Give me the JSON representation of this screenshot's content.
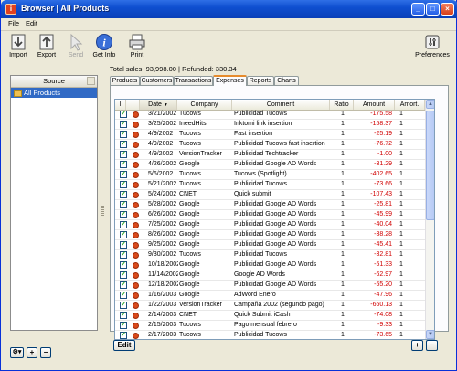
{
  "window": {
    "title": "Browser  |  All Products"
  },
  "menu": [
    "File",
    "Edit"
  ],
  "toolbar": {
    "import": "Import",
    "export": "Export",
    "send": "Send",
    "get_info": "Get Info",
    "print": "Print",
    "preferences": "Preferences"
  },
  "sidebar": {
    "header": "Source",
    "items": [
      "All Products"
    ]
  },
  "summary": "Total sales: 93,998.00 | Refunded: 330.34",
  "tabs": [
    "Products",
    "Customers",
    "Transactions",
    "Expenses",
    "Reports",
    "Charts"
  ],
  "active_tab": "Expenses",
  "table": {
    "columns": [
      "I",
      "Date",
      "Company",
      "Comment",
      "Ratio",
      "Amount",
      "Amort."
    ],
    "sort_indicator": "▼",
    "rows": [
      [
        "3/21/2002",
        "Tucows",
        "Publicidad Tucows",
        "1",
        "-175.58",
        "1"
      ],
      [
        "3/25/2002",
        "IneedHits",
        "Inktomi link insertion",
        "1",
        "-158.37",
        "1"
      ],
      [
        "4/9/2002",
        "Tucows",
        "Fast insertion",
        "1",
        "-25.19",
        "1"
      ],
      [
        "4/9/2002",
        "Tucows",
        "Publicidad Tucows fast insertion",
        "1",
        "-76.72",
        "1"
      ],
      [
        "4/9/2002",
        "VersionTracker",
        "Publicidad Techtracker",
        "1",
        "-1.00",
        "1"
      ],
      [
        "4/26/2002",
        "Google",
        "Publicidad Google AD Words",
        "1",
        "-31.29",
        "1"
      ],
      [
        "5/6/2002",
        "Tucows",
        "Tucows (Spotlight)",
        "1",
        "-402.65",
        "1"
      ],
      [
        "5/21/2002",
        "Tucows",
        "Publicidad Tucows",
        "1",
        "-73.66",
        "1"
      ],
      [
        "5/24/2002",
        "CNET",
        "Quick submit",
        "1",
        "-107.43",
        "1"
      ],
      [
        "5/28/2002",
        "Google",
        "Publicidad Google AD Words",
        "1",
        "-25.81",
        "1"
      ],
      [
        "6/26/2002",
        "Google",
        "Publicidad Google AD Words",
        "1",
        "-45.99",
        "1"
      ],
      [
        "7/25/2002",
        "Google",
        "Publicidad Google AD Words",
        "1",
        "-40.04",
        "1"
      ],
      [
        "8/26/2002",
        "Google",
        "Publicidad Google AD Words",
        "1",
        "-38.28",
        "1"
      ],
      [
        "9/25/2002",
        "Google",
        "Publicidad Google AD Words",
        "1",
        "-45.41",
        "1"
      ],
      [
        "9/30/2002",
        "Tucows",
        "Publicidad Tucows",
        "1",
        "-32.81",
        "1"
      ],
      [
        "10/18/2002",
        "Google",
        "Publicidad Google AD Words",
        "1",
        "-51.33",
        "1"
      ],
      [
        "11/14/2002",
        "Google",
        "Google AD Words",
        "1",
        "-62.97",
        "1"
      ],
      [
        "12/18/2002",
        "Google",
        "Publicidad Google AD Words",
        "1",
        "-55.20",
        "1"
      ],
      [
        "1/16/2003",
        "Google",
        "AdWord Enero",
        "1",
        "-47.96",
        "1"
      ],
      [
        "1/22/2003",
        "VersionTracker",
        "Campaña 2002 (segundo pago)",
        "1",
        "-660.13",
        "1"
      ],
      [
        "2/14/2003",
        "CNET",
        "Quick Submit iCash",
        "1",
        "-74.08",
        "1"
      ],
      [
        "2/15/2003",
        "Tucows",
        "Pago mensual febrero",
        "1",
        "-9.33",
        "1"
      ],
      [
        "2/17/2003",
        "Tucows",
        "Publicidad Tucows",
        "1",
        "-73.65",
        "1"
      ]
    ]
  },
  "buttons": {
    "edit": "Edit",
    "add": "+",
    "remove": "−",
    "gear": "⚙▾"
  },
  "colors": {
    "title_bar": "#0f4fd0",
    "selection": "#316ac5",
    "amount_negative": "#d00000",
    "active_tab_accent": "#e68b2c"
  }
}
